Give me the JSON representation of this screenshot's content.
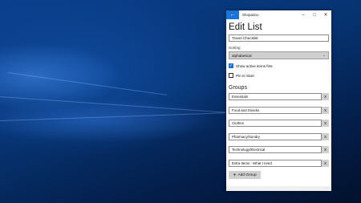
{
  "app": {
    "title": "Shopadoo",
    "back_glyph": "←",
    "minimize_glyph": "–",
    "maximize_glyph": "□",
    "close_glyph": "✕"
  },
  "page": {
    "title": "Edit List",
    "list_name_value": "Travel Checklist"
  },
  "sorting": {
    "label": "Sorting",
    "selected": "alphabetical",
    "chevron": "⌄"
  },
  "options": {
    "show_active_first": {
      "label": "Show active items first",
      "checked": true
    },
    "pin_to_start": {
      "label": "Pin to Start",
      "checked": false
    }
  },
  "groups": {
    "heading": "Groups",
    "delete_label": "X",
    "items": [
      "Essentials",
      "Food and Snacks",
      "Clothes",
      "Pharmacy/Sundry",
      "Technology/Electrical",
      "Extra Items - What I need"
    ],
    "add_label": "Add Group",
    "add_glyph": "+"
  },
  "footer": {
    "more_glyph": "···"
  },
  "colors": {
    "accent": "#1a73d6",
    "desktop": "#06326f"
  }
}
